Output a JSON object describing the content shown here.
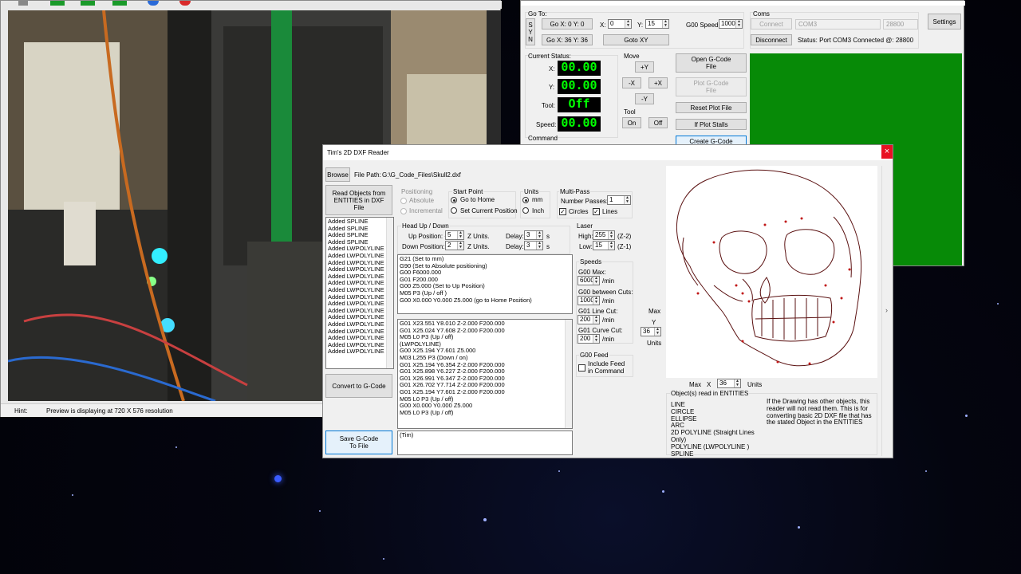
{
  "webcam": {
    "hint_label": "Hint:",
    "hint_text": "Preview is displaying at 720 X 576 resolution"
  },
  "plotter": {
    "goto_group": "Go To:",
    "syn": [
      "S",
      "Y",
      "N"
    ],
    "go_x0y0": "Go X: 0 Y: 0",
    "go_x36y36": "Go X: 36  Y: 36",
    "x_label": "X:",
    "x_value": "0",
    "y_label": "Y:",
    "y_value": "15",
    "goto_xy": "Goto  XY",
    "g00_speed_label": "G00 Speed:",
    "g00_speed_value": "1000",
    "coms_group": "Coms",
    "connect": "Connect",
    "com_port": "COM3",
    "baud": "28800",
    "disconnect": "Disconnect",
    "status": "Status:  Port COM3 Connected @: 28800",
    "settings": "Settings",
    "current_status": "Current Status:",
    "x": "X:",
    "y": "Y:",
    "tool": "Tool:",
    "speed": "Speed:",
    "x_val": "00.00",
    "y_val": "00.00",
    "tool_val": "Off",
    "speed_val": "00.00",
    "move_group": "Move",
    "plus_y": "+Y",
    "minus_x": "-X",
    "plus_x": "+X",
    "minus_y": "-Y",
    "tool_group": "Tool",
    "on": "On",
    "off": "Off",
    "command_group": "Command",
    "open_gcode": "Open G-Code File",
    "plot_gcode": "Plot G-Code File",
    "reset_plot": "Reset Plot File",
    "if_plot_stalls": "If Plot Stalls",
    "create_gcode": "Create G-Code"
  },
  "dxf": {
    "title": "Tim's 2D DXF Reader",
    "close": "×",
    "browse": "Browse",
    "file_path_label": "File Path:",
    "file_path": "G:\\G_Code_Files\\Skull2.dxf",
    "read_objects": "Read Objects from ENTITIES in DXF File",
    "entity_list": [
      "Added SPLINE",
      "Added SPLINE",
      "Added SPLINE",
      "Added SPLINE",
      "Added LWPOLYLINE",
      "Added LWPOLYLINE",
      "Added LWPOLYLINE",
      "Added LWPOLYLINE",
      "Added LWPOLYLINE",
      "Added LWPOLYLINE",
      "Added LWPOLYLINE",
      "Added LWPOLYLINE",
      "Added LWPOLYLINE",
      "Added LWPOLYLINE",
      "Added LWPOLYLINE",
      "Added LWPOLYLINE",
      "Added LWPOLYLINE",
      "Added LWPOLYLINE",
      "Added LWPOLYLINE",
      "Added LWPOLYLINE"
    ],
    "convert": "Convert to G-Code",
    "save": "Save G-Code To File",
    "positioning": "Positioning",
    "absolute": "Absolute",
    "incremental": "Incremental",
    "start_point": "Start Point",
    "go_home": "Go to Home",
    "set_current": "Set Current Position",
    "units": "Units",
    "mm": "mm",
    "inch": "Inch",
    "multipass": "Multi-Pass",
    "num_passes": "Number Passes:",
    "passes_value": "1",
    "circles": "Circles",
    "lines": "Lines",
    "head": "Head Up / Down",
    "up_pos": "Up Position:  +",
    "up_val": "5",
    "down_pos": "Down Position:  -",
    "down_val": "2",
    "z_units": "Z Units.",
    "delay": "Delay:",
    "delay_up": "3",
    "delay_down": "3",
    "s": "s",
    "laser": "Laser",
    "high": "High:",
    "high_val": "255",
    "high_z": "(Z-2)",
    "low": "Low:",
    "low_val": "15",
    "low_z": "(Z-1)",
    "speeds": "Speeds",
    "g00_max": "G00 Max:",
    "g00_max_val": "6000",
    "between": "G00 between Cuts:",
    "between_val": "1000",
    "line_cut": "G01 Line Cut:",
    "line_val": "200",
    "curve_cut": "G01 Curve Cut:",
    "curve_val": "200",
    "per_min": "/min",
    "g00_feed": "G00 Feed",
    "include_feed": "Include Feed in Command",
    "header_code": [
      "G21 (Set to mm)",
      "G90 (Set to Absolute positioning)",
      "G00 F6000.000",
      "G01 F200.000",
      "G00 Z5.000 (Set to Up Position)",
      "M05 P3 (Up / off )",
      "G00 X0.000 Y0.000 Z5.000 (go to Home Position)"
    ],
    "body_code": [
      "G01 X23.551 Y8.010 Z-2.000 F200.000",
      "G01 X25.024 Y7.608 Z-2.000 F200.000",
      "M05 L0 P3 (Up / off)",
      "(LWPOLYLINE)",
      "G00 X25.194 Y7.601 Z5.000",
      "M03 L255 P3 (Down / on)",
      "G01 X25.194 Y6.354 Z-2.000 F200.000",
      "G01 X25.898 Y6.227 Z-2.000 F200.000",
      "G01 X26.991 Y6.347 Z-2.000 F200.000",
      "G01 X26.702 Y7.714 Z-2.000 F200.000",
      "G01 X25.194 Y7.601 Z-2.000 F200.000",
      "M05 L0 P3 (Up / off)",
      "G00 X0.000 Y0.000 Z5.000",
      "M05 L0 P3 (Up / off)"
    ],
    "comment": "(Tim)",
    "max": "Max",
    "y_axis": "Y",
    "y_max_val": "36",
    "units_label": "Units",
    "x_axis": "X",
    "x_max_val": "36",
    "units_label2": "Units",
    "objects_title": "Object(s) read in ENTITIES",
    "objects": [
      "LINE",
      "CIRCLE",
      "ELLIPSE",
      "ARC",
      "2D POLYLINE (Straight Lines Only)",
      "POLYLINE (LWPOLYLINE )",
      "SPLINE"
    ],
    "info": "If the Drawing has other objects, this reader will not read them. This is for converting basic 2D DXF file that has the stated Object in the ENTITIES",
    "side_arrow": "›"
  }
}
